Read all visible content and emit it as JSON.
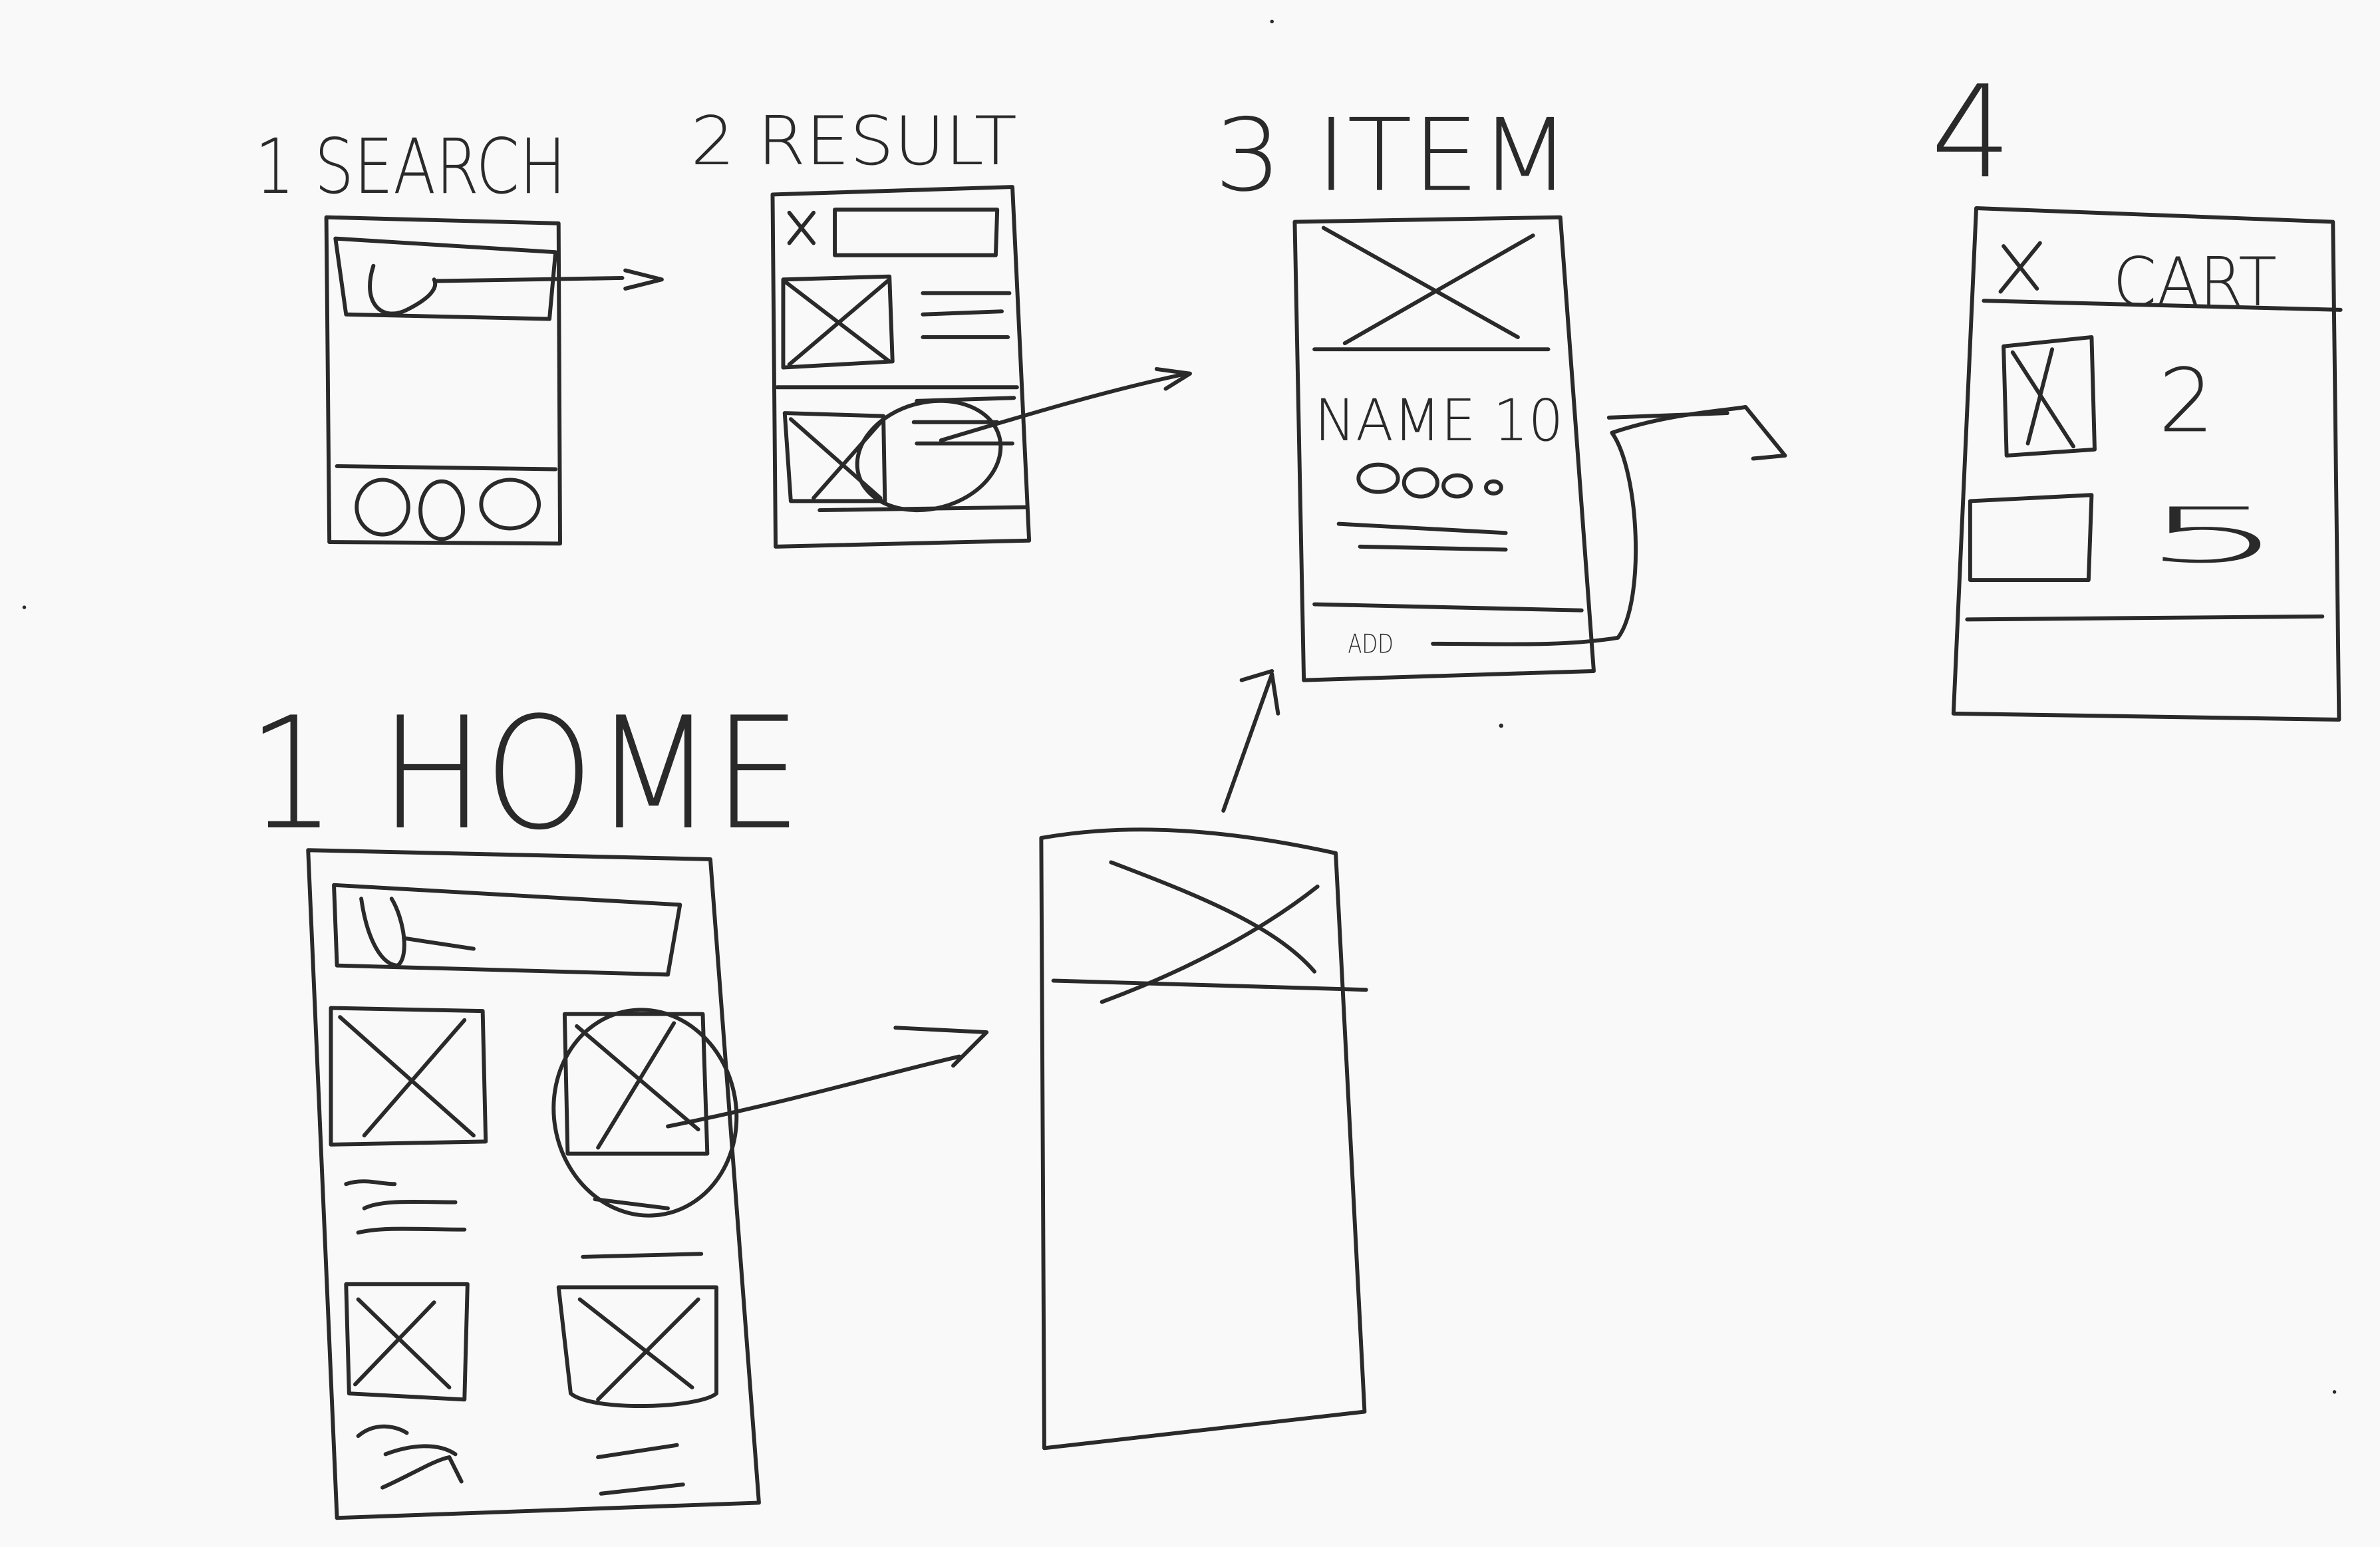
{
  "titles": {
    "search": "1 SEARCH",
    "result": "2 RESULT",
    "item": "3 ITEM",
    "cart_step": "4",
    "home": "1 HOME"
  },
  "item_screen": {
    "name_label": "NAME 10",
    "add_label": "ADD"
  },
  "cart_screen": {
    "header": "CART",
    "quantities": [
      "2",
      "5"
    ]
  },
  "ink_color": "#2a2a2a",
  "background_color": "#f9f9f9"
}
